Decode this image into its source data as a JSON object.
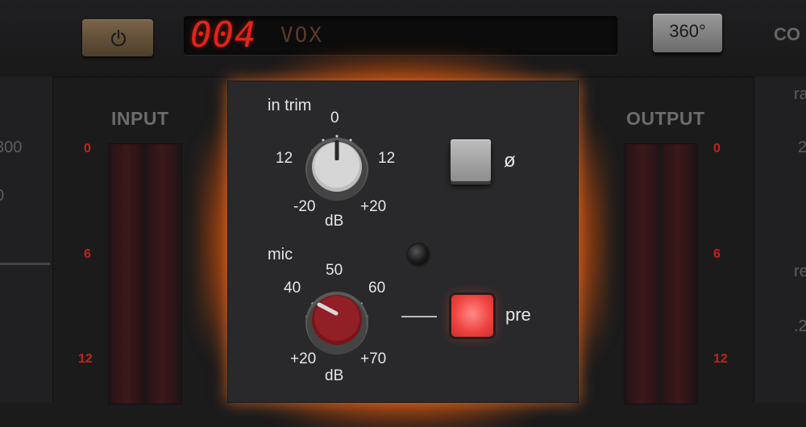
{
  "header": {
    "preset_number": "004",
    "preset_name": "VOX",
    "view_button": "360°",
    "partial_right_label": "CO"
  },
  "input_meter": {
    "title": "INPUT",
    "marks": [
      "0",
      "6",
      "12"
    ]
  },
  "output_meter": {
    "title": "OUTPUT",
    "marks": [
      "0",
      "6",
      "12"
    ]
  },
  "left_panel": {
    "partial_value_1": "300",
    "partial_value_2": "0"
  },
  "right_panel": {
    "partial_label_1": "ra",
    "partial_value_1": "2",
    "partial_label_2": "re",
    "partial_value_2": ".2"
  },
  "module": {
    "in_trim": {
      "label": "in trim",
      "scale_top": "0",
      "scale_left": "12",
      "scale_right": "12",
      "scale_min": "-20",
      "scale_max": "+20",
      "unit": "dB"
    },
    "phase": {
      "label": "ø"
    },
    "mic": {
      "label": "mic",
      "scale_top": "50",
      "scale_left": "40",
      "scale_right": "60",
      "scale_min": "+20",
      "scale_max": "+70",
      "unit": "dB"
    },
    "pre": {
      "label": "pre"
    }
  },
  "colors": {
    "background": "#1b1b1c",
    "module": "#29292b",
    "glow": "#ff6a14",
    "display_red": "#e2241a",
    "meter_mark_red": "#c4231a",
    "mic_knob_red": "#8e1c22",
    "pre_button_red": "#f0413d"
  },
  "icons": {
    "power": "power-icon",
    "phase": "phase-invert-icon"
  }
}
